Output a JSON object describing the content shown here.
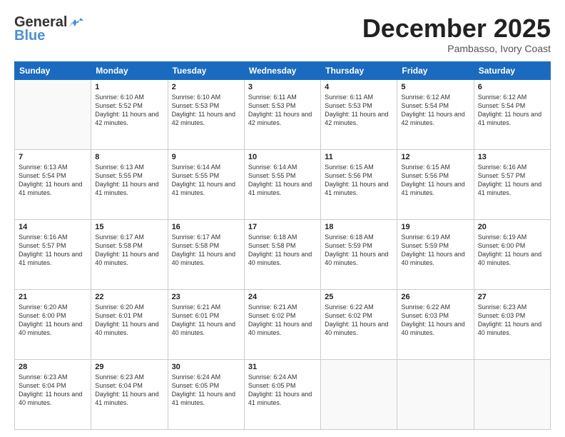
{
  "header": {
    "logo_general": "General",
    "logo_blue": "Blue",
    "month_title": "December 2025",
    "location": "Pambasso, Ivory Coast"
  },
  "days_of_week": [
    "Sunday",
    "Monday",
    "Tuesday",
    "Wednesday",
    "Thursday",
    "Friday",
    "Saturday"
  ],
  "weeks": [
    [
      {
        "day": "",
        "sunrise": "",
        "sunset": "",
        "daylight": "",
        "empty": true
      },
      {
        "day": "1",
        "sunrise": "Sunrise: 6:10 AM",
        "sunset": "Sunset: 5:52 PM",
        "daylight": "Daylight: 11 hours and 42 minutes.",
        "empty": false
      },
      {
        "day": "2",
        "sunrise": "Sunrise: 6:10 AM",
        "sunset": "Sunset: 5:53 PM",
        "daylight": "Daylight: 11 hours and 42 minutes.",
        "empty": false
      },
      {
        "day": "3",
        "sunrise": "Sunrise: 6:11 AM",
        "sunset": "Sunset: 5:53 PM",
        "daylight": "Daylight: 11 hours and 42 minutes.",
        "empty": false
      },
      {
        "day": "4",
        "sunrise": "Sunrise: 6:11 AM",
        "sunset": "Sunset: 5:53 PM",
        "daylight": "Daylight: 11 hours and 42 minutes.",
        "empty": false
      },
      {
        "day": "5",
        "sunrise": "Sunrise: 6:12 AM",
        "sunset": "Sunset: 5:54 PM",
        "daylight": "Daylight: 11 hours and 42 minutes.",
        "empty": false
      },
      {
        "day": "6",
        "sunrise": "Sunrise: 6:12 AM",
        "sunset": "Sunset: 5:54 PM",
        "daylight": "Daylight: 11 hours and 41 minutes.",
        "empty": false
      }
    ],
    [
      {
        "day": "7",
        "sunrise": "Sunrise: 6:13 AM",
        "sunset": "Sunset: 5:54 PM",
        "daylight": "Daylight: 11 hours and 41 minutes.",
        "empty": false
      },
      {
        "day": "8",
        "sunrise": "Sunrise: 6:13 AM",
        "sunset": "Sunset: 5:55 PM",
        "daylight": "Daylight: 11 hours and 41 minutes.",
        "empty": false
      },
      {
        "day": "9",
        "sunrise": "Sunrise: 6:14 AM",
        "sunset": "Sunset: 5:55 PM",
        "daylight": "Daylight: 11 hours and 41 minutes.",
        "empty": false
      },
      {
        "day": "10",
        "sunrise": "Sunrise: 6:14 AM",
        "sunset": "Sunset: 5:55 PM",
        "daylight": "Daylight: 11 hours and 41 minutes.",
        "empty": false
      },
      {
        "day": "11",
        "sunrise": "Sunrise: 6:15 AM",
        "sunset": "Sunset: 5:56 PM",
        "daylight": "Daylight: 11 hours and 41 minutes.",
        "empty": false
      },
      {
        "day": "12",
        "sunrise": "Sunrise: 6:15 AM",
        "sunset": "Sunset: 5:56 PM",
        "daylight": "Daylight: 11 hours and 41 minutes.",
        "empty": false
      },
      {
        "day": "13",
        "sunrise": "Sunrise: 6:16 AM",
        "sunset": "Sunset: 5:57 PM",
        "daylight": "Daylight: 11 hours and 41 minutes.",
        "empty": false
      }
    ],
    [
      {
        "day": "14",
        "sunrise": "Sunrise: 6:16 AM",
        "sunset": "Sunset: 5:57 PM",
        "daylight": "Daylight: 11 hours and 41 minutes.",
        "empty": false
      },
      {
        "day": "15",
        "sunrise": "Sunrise: 6:17 AM",
        "sunset": "Sunset: 5:58 PM",
        "daylight": "Daylight: 11 hours and 40 minutes.",
        "empty": false
      },
      {
        "day": "16",
        "sunrise": "Sunrise: 6:17 AM",
        "sunset": "Sunset: 5:58 PM",
        "daylight": "Daylight: 11 hours and 40 minutes.",
        "empty": false
      },
      {
        "day": "17",
        "sunrise": "Sunrise: 6:18 AM",
        "sunset": "Sunset: 5:58 PM",
        "daylight": "Daylight: 11 hours and 40 minutes.",
        "empty": false
      },
      {
        "day": "18",
        "sunrise": "Sunrise: 6:18 AM",
        "sunset": "Sunset: 5:59 PM",
        "daylight": "Daylight: 11 hours and 40 minutes.",
        "empty": false
      },
      {
        "day": "19",
        "sunrise": "Sunrise: 6:19 AM",
        "sunset": "Sunset: 5:59 PM",
        "daylight": "Daylight: 11 hours and 40 minutes.",
        "empty": false
      },
      {
        "day": "20",
        "sunrise": "Sunrise: 6:19 AM",
        "sunset": "Sunset: 6:00 PM",
        "daylight": "Daylight: 11 hours and 40 minutes.",
        "empty": false
      }
    ],
    [
      {
        "day": "21",
        "sunrise": "Sunrise: 6:20 AM",
        "sunset": "Sunset: 6:00 PM",
        "daylight": "Daylight: 11 hours and 40 minutes.",
        "empty": false
      },
      {
        "day": "22",
        "sunrise": "Sunrise: 6:20 AM",
        "sunset": "Sunset: 6:01 PM",
        "daylight": "Daylight: 11 hours and 40 minutes.",
        "empty": false
      },
      {
        "day": "23",
        "sunrise": "Sunrise: 6:21 AM",
        "sunset": "Sunset: 6:01 PM",
        "daylight": "Daylight: 11 hours and 40 minutes.",
        "empty": false
      },
      {
        "day": "24",
        "sunrise": "Sunrise: 6:21 AM",
        "sunset": "Sunset: 6:02 PM",
        "daylight": "Daylight: 11 hours and 40 minutes.",
        "empty": false
      },
      {
        "day": "25",
        "sunrise": "Sunrise: 6:22 AM",
        "sunset": "Sunset: 6:02 PM",
        "daylight": "Daylight: 11 hours and 40 minutes.",
        "empty": false
      },
      {
        "day": "26",
        "sunrise": "Sunrise: 6:22 AM",
        "sunset": "Sunset: 6:03 PM",
        "daylight": "Daylight: 11 hours and 40 minutes.",
        "empty": false
      },
      {
        "day": "27",
        "sunrise": "Sunrise: 6:23 AM",
        "sunset": "Sunset: 6:03 PM",
        "daylight": "Daylight: 11 hours and 40 minutes.",
        "empty": false
      }
    ],
    [
      {
        "day": "28",
        "sunrise": "Sunrise: 6:23 AM",
        "sunset": "Sunset: 6:04 PM",
        "daylight": "Daylight: 11 hours and 40 minutes.",
        "empty": false
      },
      {
        "day": "29",
        "sunrise": "Sunrise: 6:23 AM",
        "sunset": "Sunset: 6:04 PM",
        "daylight": "Daylight: 11 hours and 41 minutes.",
        "empty": false
      },
      {
        "day": "30",
        "sunrise": "Sunrise: 6:24 AM",
        "sunset": "Sunset: 6:05 PM",
        "daylight": "Daylight: 11 hours and 41 minutes.",
        "empty": false
      },
      {
        "day": "31",
        "sunrise": "Sunrise: 6:24 AM",
        "sunset": "Sunset: 6:05 PM",
        "daylight": "Daylight: 11 hours and 41 minutes.",
        "empty": false
      },
      {
        "day": "",
        "sunrise": "",
        "sunset": "",
        "daylight": "",
        "empty": true
      },
      {
        "day": "",
        "sunrise": "",
        "sunset": "",
        "daylight": "",
        "empty": true
      },
      {
        "day": "",
        "sunrise": "",
        "sunset": "",
        "daylight": "",
        "empty": true
      }
    ]
  ]
}
